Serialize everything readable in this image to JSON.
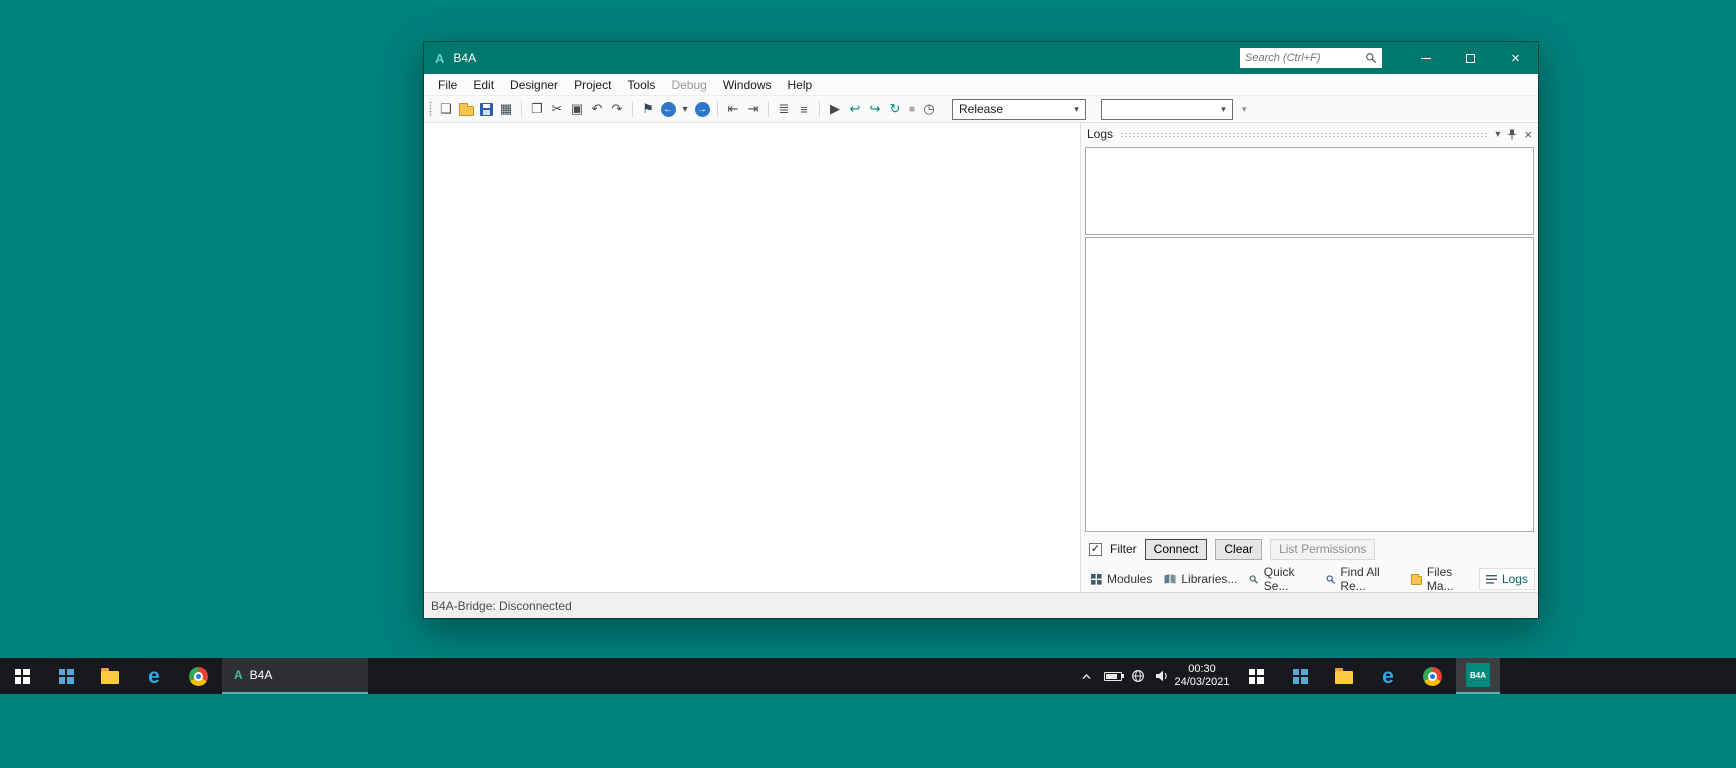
{
  "colors": {
    "desktop": "#00807B",
    "titlebar": "#00786D",
    "accent_teal": "#00897B",
    "taskbar": "#17191C"
  },
  "window": {
    "title": "B4A",
    "icon_letter": "A",
    "search_placeholder": "Search (Ctrl+F)"
  },
  "menu": {
    "items": [
      {
        "label": "File",
        "enabled": true
      },
      {
        "label": "Edit",
        "enabled": true
      },
      {
        "label": "Designer",
        "enabled": true
      },
      {
        "label": "Project",
        "enabled": true
      },
      {
        "label": "Tools",
        "enabled": true
      },
      {
        "label": "Debug",
        "enabled": false
      },
      {
        "label": "Windows",
        "enabled": true
      },
      {
        "label": "Help",
        "enabled": true
      }
    ]
  },
  "toolbar": {
    "build_config": "Release",
    "module_selector": ""
  },
  "logs": {
    "title": "Logs",
    "filter_label": "Filter",
    "connect_label": "Connect",
    "clear_label": "Clear",
    "list_permissions_label": "List Permissions",
    "tabs": [
      {
        "label": "Modules",
        "active": false
      },
      {
        "label": "Libraries...",
        "active": false
      },
      {
        "label": "Quick Se...",
        "active": false
      },
      {
        "label": "Find All Re...",
        "active": false
      },
      {
        "label": "Files Ma...",
        "active": false
      },
      {
        "label": "Logs",
        "active": true
      }
    ]
  },
  "status": {
    "text": "B4A-Bridge: Disconnected"
  },
  "taskbar": {
    "app_label": "B4A",
    "app_letter": "A",
    "b4a_tile_label": "B4A",
    "time": "00:30",
    "date": "24/03/2021"
  },
  "glyphs": {
    "minimize": "–",
    "close": "×",
    "caret_down": "▾",
    "new_file": "❏",
    "export_zip": "▦",
    "copy": "❐",
    "cut": "✂",
    "paste": "▣",
    "undo": "↶",
    "redo": "↷",
    "bookmark": "⚑",
    "back_arrow": "←",
    "forward_arrow": "→",
    "nav_left": "⇤",
    "nav_right": "⇥",
    "comment": "≣",
    "uncomment": "≡",
    "run": "▶",
    "resume": "↩",
    "step_over": "↪",
    "restart": "↻",
    "stop": "■",
    "compile_timer": "◷",
    "check": "✓"
  }
}
